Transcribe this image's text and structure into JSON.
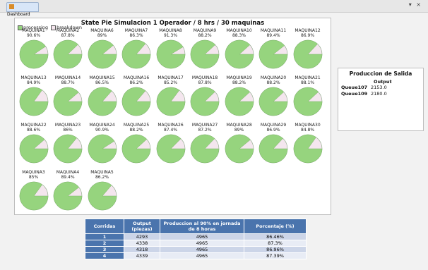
{
  "window": {
    "tab_label": "Dashboard",
    "controls": "▾ ×"
  },
  "chart": {
    "title": "State Pie  Simulacion 1 Operador / 8 hrs / 30 maquinas",
    "legend": [
      {
        "label": "processing",
        "color": "#96d47e"
      },
      {
        "label": "breakdown",
        "color": "#f4e6ee"
      }
    ]
  },
  "chart_data": {
    "type": "pie",
    "title": "State Pie  Simulacion 1 Operador / 8 hrs / 30 maquinas",
    "series_labels": [
      "processing",
      "breakdown"
    ],
    "colors": {
      "processing": "#96d47e",
      "breakdown": "#f4e6ee"
    },
    "pies": [
      {
        "name": "MAQUINA1",
        "label": "90.6%",
        "value": 90.6
      },
      {
        "name": "MAQUINA2",
        "label": "87.8%",
        "value": 87.8
      },
      {
        "name": "MAQUINA6",
        "label": "89%",
        "value": 89
      },
      {
        "name": "MAQUINA7",
        "label": "86.3%",
        "value": 86.3
      },
      {
        "name": "MAQUINA8",
        "label": "91.3%",
        "value": 91.3
      },
      {
        "name": "MAQUINA9",
        "label": "88.2%",
        "value": 88.2
      },
      {
        "name": "MAQUINA10",
        "label": "88.3%",
        "value": 88.3
      },
      {
        "name": "MAQUINA11",
        "label": "89.4%",
        "value": 89.4
      },
      {
        "name": "MAQUINA12",
        "label": "86.9%",
        "value": 86.9
      },
      {
        "name": "MAQUINA13",
        "label": "84.9%",
        "value": 84.9
      },
      {
        "name": "MAQUINA14",
        "label": "88.7%",
        "value": 88.7
      },
      {
        "name": "MAQUINA15",
        "label": "86.5%",
        "value": 86.5
      },
      {
        "name": "MAQUINA16",
        "label": "86.2%",
        "value": 86.2
      },
      {
        "name": "MAQUINA17",
        "label": "85.2%",
        "value": 85.2
      },
      {
        "name": "MAQUINA18",
        "label": "87.8%",
        "value": 87.8
      },
      {
        "name": "MAQUINA19",
        "label": "88.2%",
        "value": 88.2
      },
      {
        "name": "MAQUINA20",
        "label": "88.2%",
        "value": 88.2
      },
      {
        "name": "MAQUINA21",
        "label": "88.1%",
        "value": 88.1
      },
      {
        "name": "MAQUINA22",
        "label": "88.6%",
        "value": 88.6
      },
      {
        "name": "MAQUINA23",
        "label": "86%",
        "value": 86
      },
      {
        "name": "MAQUINA24",
        "label": "90.9%",
        "value": 90.9
      },
      {
        "name": "MAQUINA25",
        "label": "88.2%",
        "value": 88.2
      },
      {
        "name": "MAQUINA26",
        "label": "87.4%",
        "value": 87.4
      },
      {
        "name": "MAQUINA27",
        "label": "87.2%",
        "value": 87.2
      },
      {
        "name": "MAQUINA28",
        "label": "89%",
        "value": 89
      },
      {
        "name": "MAQUINA29",
        "label": "86.9%",
        "value": 86.9
      },
      {
        "name": "MAQUINA30",
        "label": "84.8%",
        "value": 84.8
      },
      {
        "name": "MAQUINA3",
        "label": "85%",
        "value": 85
      },
      {
        "name": "MAQUINA4",
        "label": "89.4%",
        "value": 89.4
      },
      {
        "name": "MAQUINA5",
        "label": "86.2%",
        "value": 86.2
      }
    ]
  },
  "output_panel": {
    "title": "Produccion de Salida",
    "column": "Output",
    "rows": [
      {
        "name": "Queue107",
        "value": "2153.0"
      },
      {
        "name": "Queue109",
        "value": "2180.0"
      }
    ]
  },
  "results_table": {
    "headers": [
      "Corridas",
      "Output (piezas)",
      "Produccion al 90% en jornada de 8 horas",
      "Porcentaje (%)"
    ],
    "rows": [
      [
        "1",
        "4293",
        "4965",
        "86.46%"
      ],
      [
        "2",
        "4338",
        "4965",
        "87.3%"
      ],
      [
        "3",
        "4318",
        "4965",
        "86.96%"
      ],
      [
        "4",
        "4339",
        "4965",
        "87.39%"
      ]
    ]
  }
}
